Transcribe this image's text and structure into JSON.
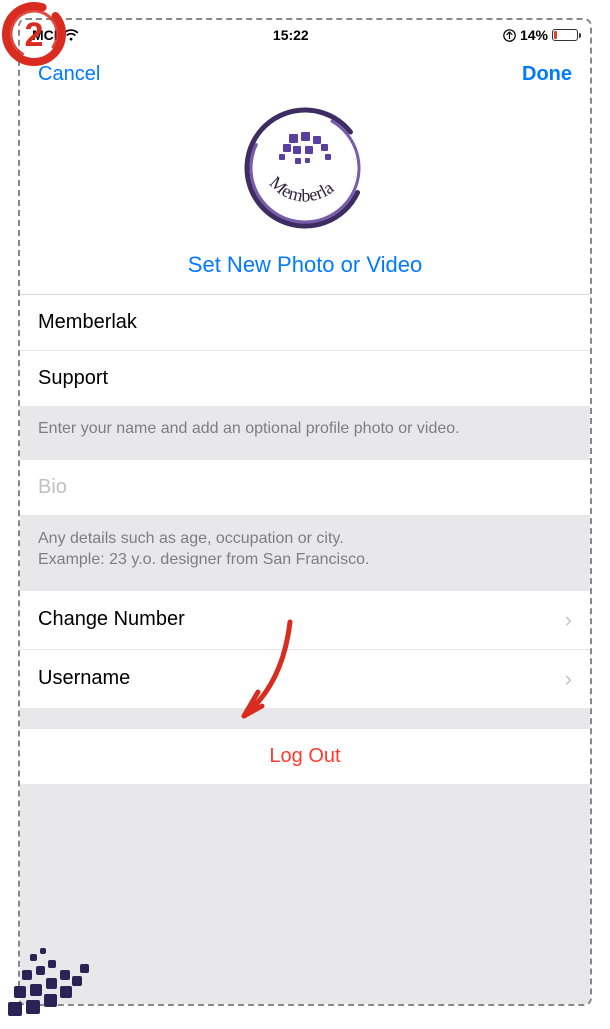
{
  "annotation": {
    "step_number": "2"
  },
  "status": {
    "carrier": "MCI",
    "time": "15:22",
    "battery_percent": "14%"
  },
  "nav": {
    "cancel": "Cancel",
    "done": "Done"
  },
  "avatar": {
    "logo_text": "Memberlak",
    "set_photo": "Set New Photo or Video"
  },
  "name_fields": {
    "first": "Memberlak",
    "last": "Support"
  },
  "hints": {
    "name": "Enter your name and add an optional profile photo or video.",
    "bio": "Any details such as age, occupation or city.\nExample: 23 y.o. designer from San Francisco."
  },
  "bio": {
    "placeholder": "Bio",
    "value": ""
  },
  "rows": {
    "change_number": "Change Number",
    "username": "Username"
  },
  "logout": "Log Out",
  "colors": {
    "accent": "#007aff",
    "destructive": "#ff3b30",
    "annotation_red": "#d92b1f",
    "logo_purple": "#4a2e7a"
  }
}
